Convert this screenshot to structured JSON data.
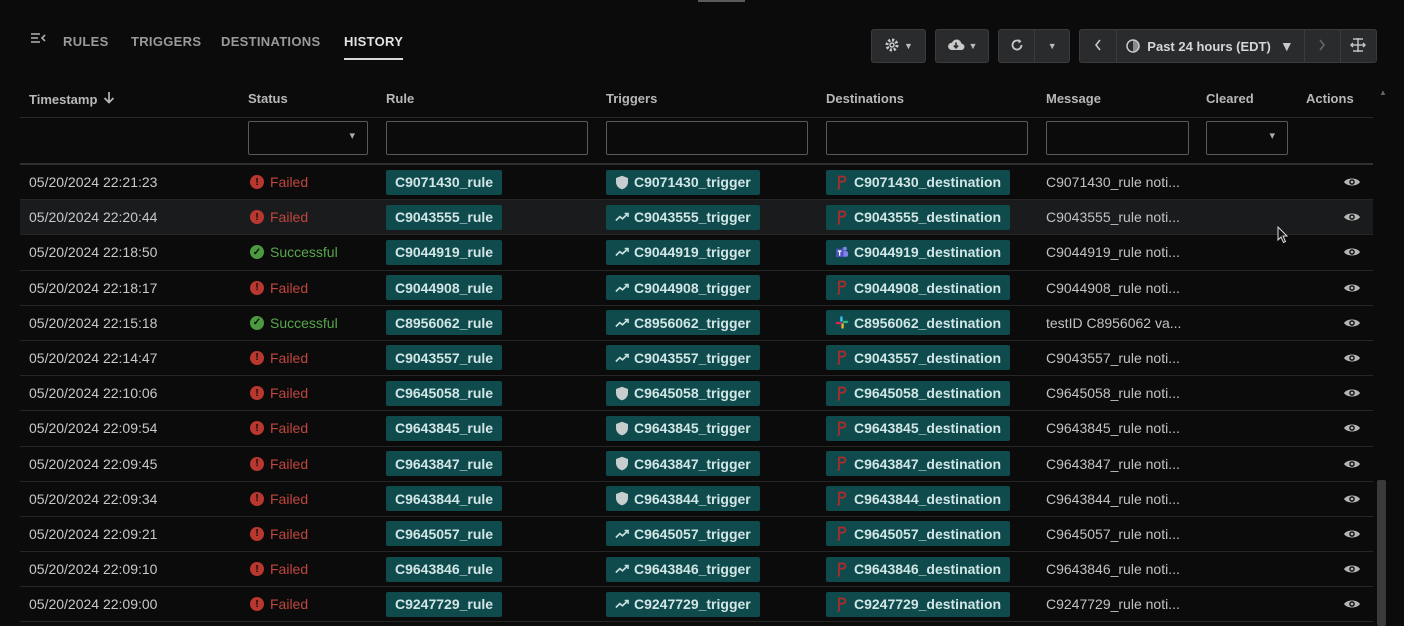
{
  "nav": {
    "tabs": [
      {
        "label": "RULES",
        "active": false
      },
      {
        "label": "TRIGGERS",
        "active": false
      },
      {
        "label": "DESTINATIONS",
        "active": false
      },
      {
        "label": "HISTORY",
        "active": true
      }
    ]
  },
  "toolbar": {
    "settings_icon": "gear-icon",
    "export_icon": "cloud-download-icon",
    "refresh_icon": "refresh-icon",
    "time_range": "Past 24 hours (EDT)"
  },
  "columns": {
    "timestamp": "Timestamp",
    "status": "Status",
    "rule": "Rule",
    "triggers": "Triggers",
    "destinations": "Destinations",
    "message": "Message",
    "cleared": "Cleared",
    "actions": "Actions"
  },
  "colors": {
    "chip_bg": "#0f4a4d",
    "failed": "#c0453c",
    "success": "#57a84a"
  },
  "rows": [
    {
      "timestamp": "05/20/2024 22:21:23",
      "status": "Failed",
      "rule": "C9071430_rule",
      "trigger": "C9071430_trigger",
      "trigger_icon": "shield-icon",
      "destination": "C9071430_destination",
      "dest_icon": "pagerduty-icon",
      "message": "C9071430_rule noti..."
    },
    {
      "timestamp": "05/20/2024 22:20:44",
      "status": "Failed",
      "rule": "C9043555_rule",
      "trigger": "C9043555_trigger",
      "trigger_icon": "trend-icon",
      "destination": "C9043555_destination",
      "dest_icon": "pagerduty-icon",
      "message": "C9043555_rule noti..."
    },
    {
      "timestamp": "05/20/2024 22:18:50",
      "status": "Successful",
      "rule": "C9044919_rule",
      "trigger": "C9044919_trigger",
      "trigger_icon": "trend-icon",
      "destination": "C9044919_destination",
      "dest_icon": "teams-icon",
      "message": "C9044919_rule noti..."
    },
    {
      "timestamp": "05/20/2024 22:18:17",
      "status": "Failed",
      "rule": "C9044908_rule",
      "trigger": "C9044908_trigger",
      "trigger_icon": "trend-icon",
      "destination": "C9044908_destination",
      "dest_icon": "pagerduty-icon",
      "message": "C9044908_rule noti..."
    },
    {
      "timestamp": "05/20/2024 22:15:18",
      "status": "Successful",
      "rule": "C8956062_rule",
      "trigger": "C8956062_trigger",
      "trigger_icon": "trend-icon",
      "destination": "C8956062_destination",
      "dest_icon": "slack-icon",
      "message": "testID C8956062 va..."
    },
    {
      "timestamp": "05/20/2024 22:14:47",
      "status": "Failed",
      "rule": "C9043557_rule",
      "trigger": "C9043557_trigger",
      "trigger_icon": "trend-icon",
      "destination": "C9043557_destination",
      "dest_icon": "pagerduty-icon",
      "message": "C9043557_rule noti..."
    },
    {
      "timestamp": "05/20/2024 22:10:06",
      "status": "Failed",
      "rule": "C9645058_rule",
      "trigger": "C9645058_trigger",
      "trigger_icon": "shield-icon",
      "destination": "C9645058_destination",
      "dest_icon": "pagerduty-icon",
      "message": "C9645058_rule noti..."
    },
    {
      "timestamp": "05/20/2024 22:09:54",
      "status": "Failed",
      "rule": "C9643845_rule",
      "trigger": "C9643845_trigger",
      "trigger_icon": "shield-icon",
      "destination": "C9643845_destination",
      "dest_icon": "pagerduty-icon",
      "message": "C9643845_rule noti..."
    },
    {
      "timestamp": "05/20/2024 22:09:45",
      "status": "Failed",
      "rule": "C9643847_rule",
      "trigger": "C9643847_trigger",
      "trigger_icon": "shield-icon",
      "destination": "C9643847_destination",
      "dest_icon": "pagerduty-icon",
      "message": "C9643847_rule noti..."
    },
    {
      "timestamp": "05/20/2024 22:09:34",
      "status": "Failed",
      "rule": "C9643844_rule",
      "trigger": "C9643844_trigger",
      "trigger_icon": "shield-icon",
      "destination": "C9643844_destination",
      "dest_icon": "pagerduty-icon",
      "message": "C9643844_rule noti..."
    },
    {
      "timestamp": "05/20/2024 22:09:21",
      "status": "Failed",
      "rule": "C9645057_rule",
      "trigger": "C9645057_trigger",
      "trigger_icon": "trend-icon",
      "destination": "C9645057_destination",
      "dest_icon": "pagerduty-icon",
      "message": "C9645057_rule noti..."
    },
    {
      "timestamp": "05/20/2024 22:09:10",
      "status": "Failed",
      "rule": "C9643846_rule",
      "trigger": "C9643846_trigger",
      "trigger_icon": "trend-icon",
      "destination": "C9643846_destination",
      "dest_icon": "pagerduty-icon",
      "message": "C9643846_rule noti..."
    },
    {
      "timestamp": "05/20/2024 22:09:00",
      "status": "Failed",
      "rule": "C9247729_rule",
      "trigger": "C9247729_trigger",
      "trigger_icon": "trend-icon",
      "destination": "C9247729_destination",
      "dest_icon": "pagerduty-icon",
      "message": "C9247729_rule noti..."
    }
  ]
}
